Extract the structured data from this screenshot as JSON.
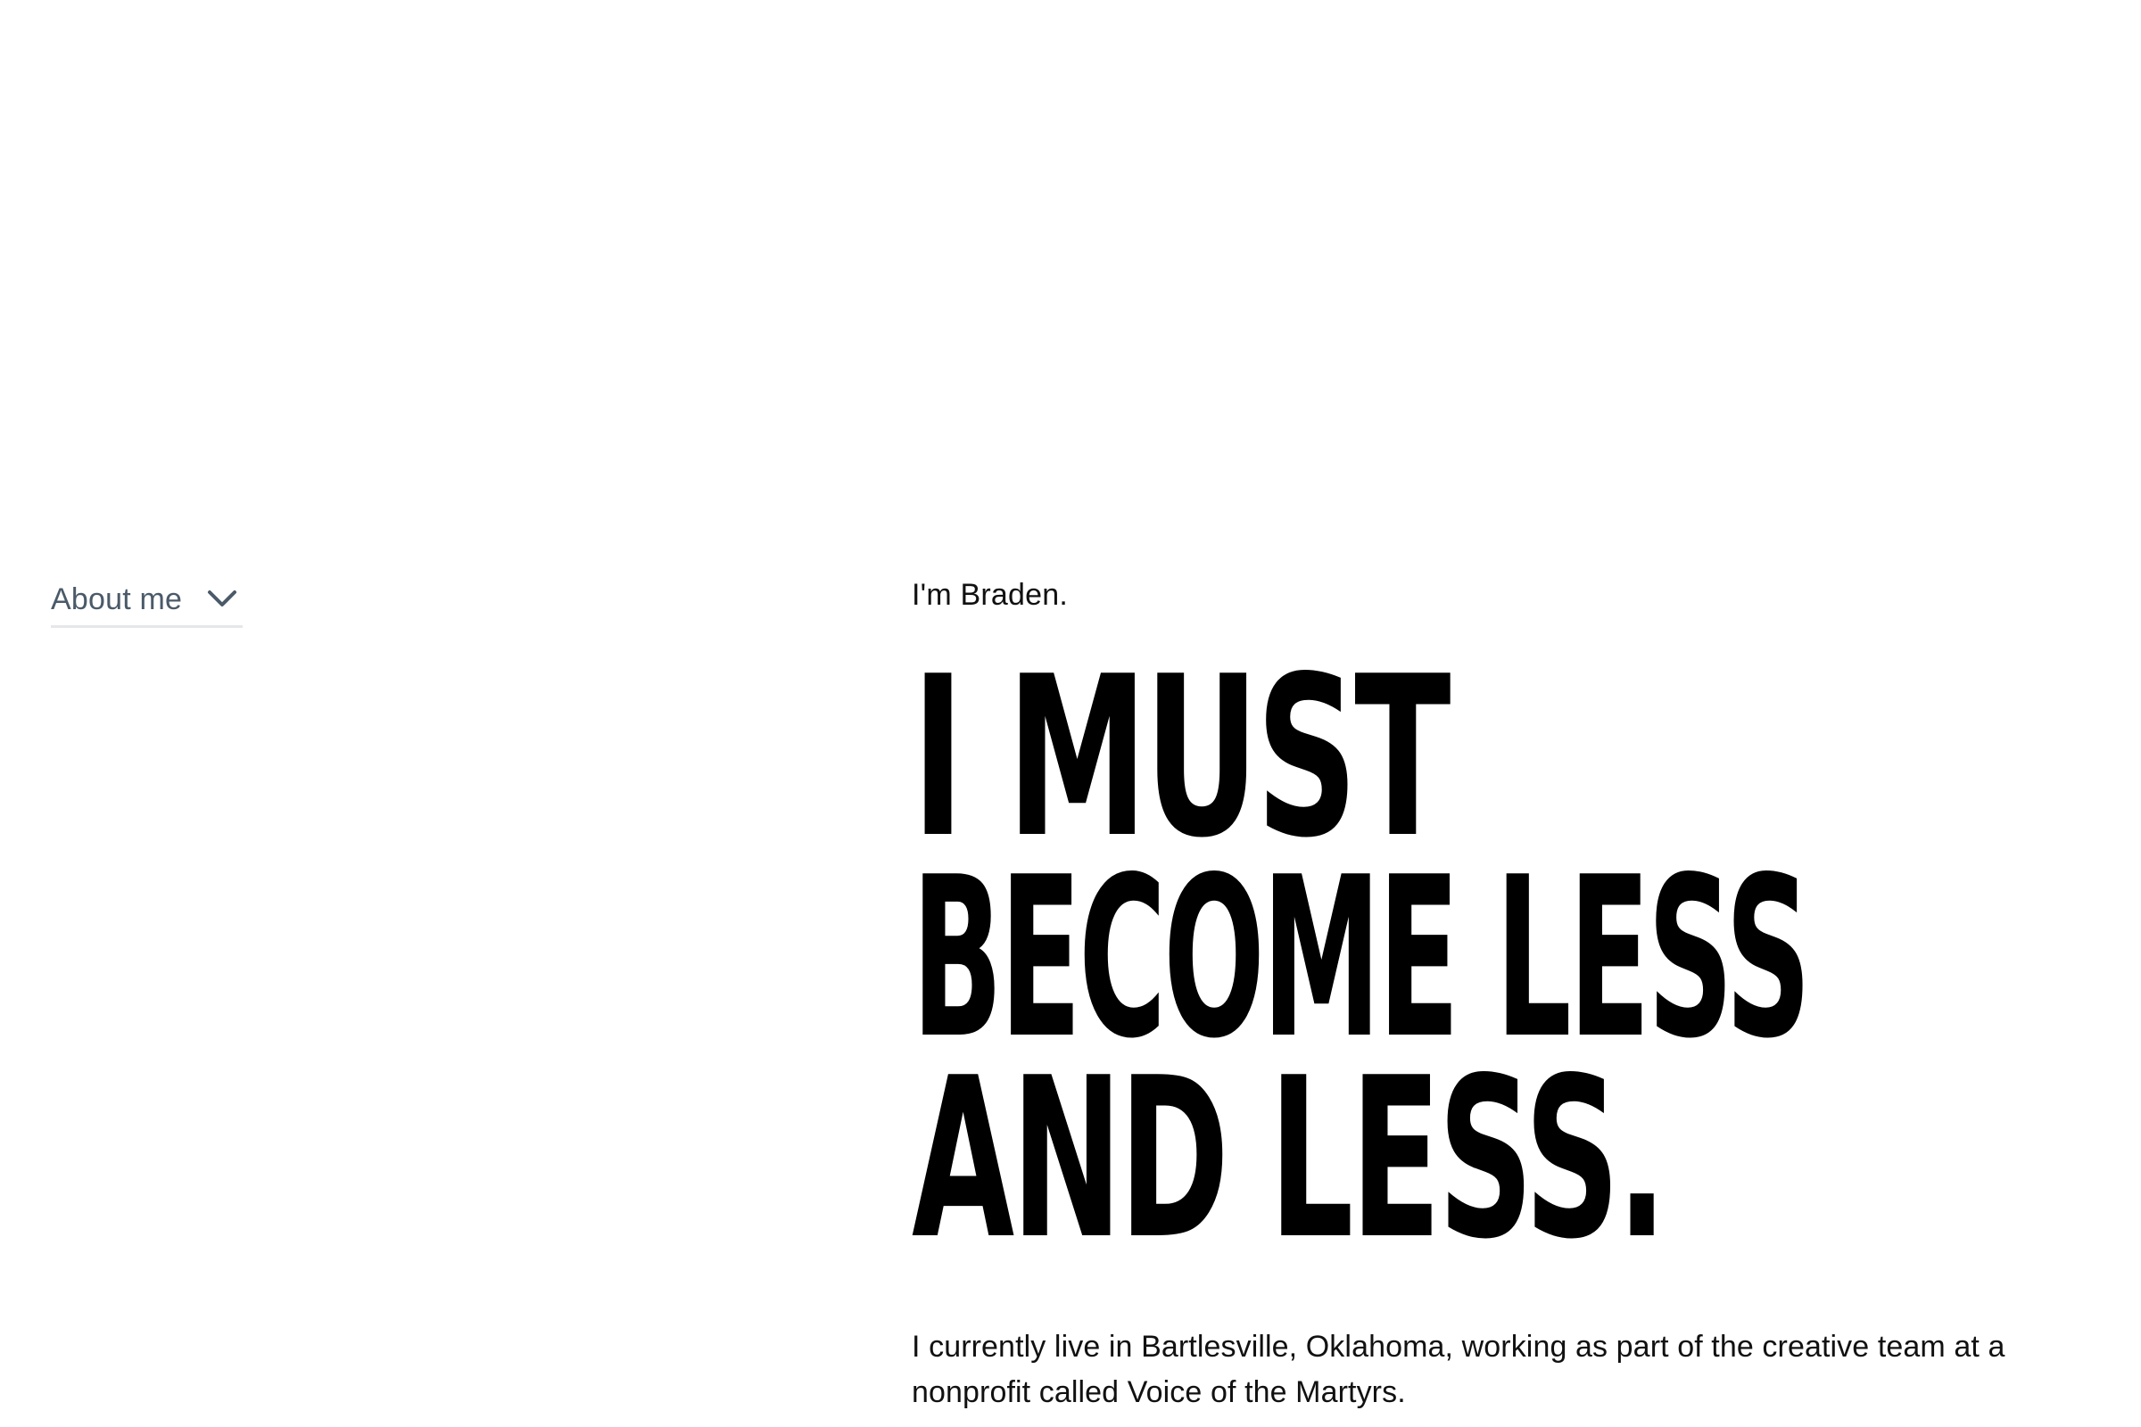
{
  "nav": {
    "dropdown_label": "About me",
    "dropdown_icon": "chevron-down-icon",
    "label_color": "#4b5a69"
  },
  "main": {
    "intro": "I'm Braden.",
    "headline": {
      "line1": "I MUST",
      "line2": "BECOME LESS",
      "line3": "AND LESS."
    },
    "bio": "I currently live in Bartlesville, Oklahoma, working as part of the creative team at a nonprofit called Voice of the Martyrs."
  }
}
